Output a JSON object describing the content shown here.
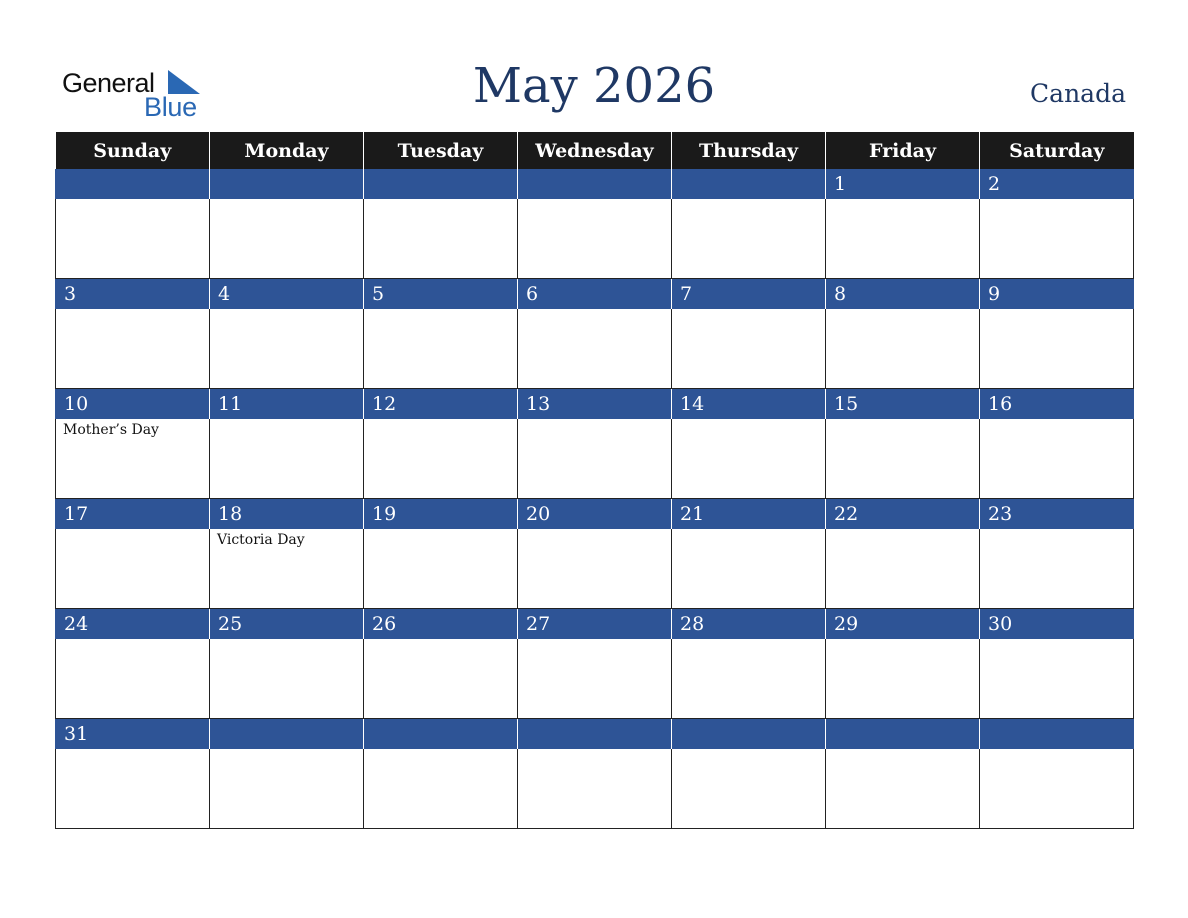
{
  "logo": {
    "line1": "General",
    "line2": "Blue",
    "icon": "triangle-flag-icon",
    "accent_color": "#2a68b4"
  },
  "title": "May 2026",
  "country": "Canada",
  "colors": {
    "header_bg": "#1a1a1a",
    "band_bg": "#2e5496",
    "title": "#1f3864"
  },
  "weekdays": [
    "Sunday",
    "Monday",
    "Tuesday",
    "Wednesday",
    "Thursday",
    "Friday",
    "Saturday"
  ],
  "weeks": [
    {
      "days": [
        "",
        "",
        "",
        "",
        "",
        "1",
        "2"
      ],
      "events": [
        "",
        "",
        "",
        "",
        "",
        "",
        ""
      ]
    },
    {
      "days": [
        "3",
        "4",
        "5",
        "6",
        "7",
        "8",
        "9"
      ],
      "events": [
        "",
        "",
        "",
        "",
        "",
        "",
        ""
      ]
    },
    {
      "days": [
        "10",
        "11",
        "12",
        "13",
        "14",
        "15",
        "16"
      ],
      "events": [
        "Mother’s Day",
        "",
        "",
        "",
        "",
        "",
        ""
      ]
    },
    {
      "days": [
        "17",
        "18",
        "19",
        "20",
        "21",
        "22",
        "23"
      ],
      "events": [
        "",
        "Victoria Day",
        "",
        "",
        "",
        "",
        ""
      ]
    },
    {
      "days": [
        "24",
        "25",
        "26",
        "27",
        "28",
        "29",
        "30"
      ],
      "events": [
        "",
        "",
        "",
        "",
        "",
        "",
        ""
      ]
    },
    {
      "days": [
        "31",
        "",
        "",
        "",
        "",
        "",
        ""
      ],
      "events": [
        "",
        "",
        "",
        "",
        "",
        "",
        ""
      ]
    }
  ]
}
